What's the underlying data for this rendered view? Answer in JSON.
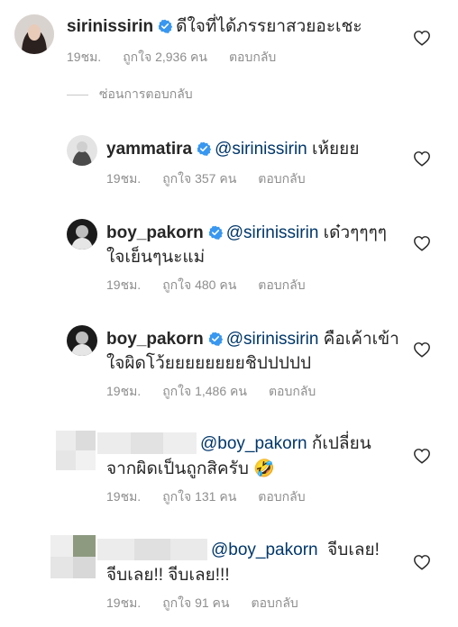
{
  "comments": [
    {
      "username": "sirinissirin",
      "verified": true,
      "mention": "",
      "text": "ดีใจที่ได้ภรรยาสวยอะเชะ",
      "time": "19ชม.",
      "likes": "ถูกใจ 2,936 คน",
      "reply": "ตอบกลับ"
    },
    {
      "username": "yammatira",
      "verified": true,
      "mention": "@sirinissirin",
      "text": "เห้ยยย",
      "time": "19ชม.",
      "likes": "ถูกใจ 357 คน",
      "reply": "ตอบกลับ"
    },
    {
      "username": "boy_pakorn",
      "verified": true,
      "mention": "@sirinissirin",
      "text": "เด๋วๆๆๆๆ",
      "text2": "ใจเย็นๆนะแม่",
      "time": "19ชม.",
      "likes": "ถูกใจ 480 คน",
      "reply": "ตอบกลับ"
    },
    {
      "username": "boy_pakorn",
      "verified": true,
      "mention": "@sirinissirin",
      "text": "คือเค้าเข้า",
      "text2": "ใจผิดโว้ยยยยยยยยชิปปปปป",
      "time": "19ชม.",
      "likes": "ถูกใจ 1,486 คน",
      "reply": "ตอบกลับ"
    },
    {
      "username": "",
      "mention": "@boy_pakorn",
      "text": "ก้เปลี่ยน",
      "text2": "จากผิดเป็นถูกสิครับ 🤣",
      "time": "19ชม.",
      "likes": "ถูกใจ 131 คน",
      "reply": "ตอบกลับ"
    },
    {
      "username": "",
      "mention": "@boy_pakorn",
      "text": "จีบเลย!",
      "text2": "จีบเลย!! จีบเลย!!!",
      "time": "19ชม.",
      "likes": "ถูกใจ 91 คน",
      "reply": "ตอบกลับ"
    }
  ],
  "hide_replies": "ซ่อนการตอบกลับ",
  "colors": {
    "verified": "#3897f0",
    "mention": "#00376b",
    "meta": "#8e8e8e"
  }
}
